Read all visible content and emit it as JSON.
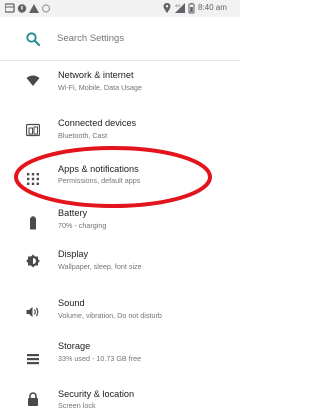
{
  "status_bar": {
    "time": "8:40 am",
    "left_icons": [
      "notification-icon",
      "android-icon",
      "alert-icon",
      "dot-icon"
    ],
    "right_icons": [
      "location-icon",
      "signal-icon",
      "battery-icon"
    ]
  },
  "search": {
    "placeholder": "Search Settings",
    "icon": "search-icon",
    "accent": "#1a8a8c"
  },
  "settings": [
    {
      "title": "Network & internet",
      "subtitle": "Wi-Fi, Mobile, Data Usage",
      "icon": "wifi-icon"
    },
    {
      "title": "Connected devices",
      "subtitle": "Bluetooth, Cast",
      "icon": "devices-icon"
    },
    {
      "title": "Apps & notifications",
      "subtitle": "Permissions, default apps",
      "icon": "apps-icon"
    },
    {
      "title": "Battery",
      "subtitle": "70% - charging",
      "icon": "battery-icon"
    },
    {
      "title": "Display",
      "subtitle": "Wallpaper, sleep, font size",
      "icon": "brightness-icon"
    },
    {
      "title": "Sound",
      "subtitle": "Volume, vibration, Do not disturb",
      "icon": "volume-icon"
    },
    {
      "title": "Storage",
      "subtitle": "33% used - 10.73 GB free",
      "icon": "storage-icon"
    },
    {
      "title": "Security & location",
      "subtitle": "Screen lock",
      "icon": "lock-icon"
    }
  ],
  "highlight": {
    "target": "Apps & notifications",
    "color": "#e3141b"
  }
}
